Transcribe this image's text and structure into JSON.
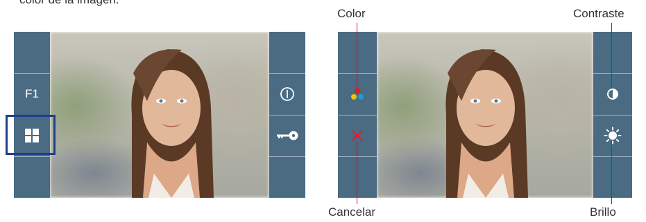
{
  "caption": "color de la imagen.",
  "left_screen": {
    "left_panel": {
      "f1_label": "F1",
      "menu_icon": "grid-icon"
    },
    "right_panel": {
      "power_icon": "power-icon",
      "key_icon": "key-icon"
    }
  },
  "right_screen": {
    "left_panel": {
      "color_icon": "color-dots-icon",
      "cancel_icon": "cancel-x-icon"
    },
    "right_panel": {
      "contrast_icon": "contrast-icon",
      "brightness_icon": "brightness-icon"
    }
  },
  "callouts": {
    "color": "Color",
    "contraste": "Contraste",
    "cancelar": "Cancelar",
    "brillo": "Brillo"
  },
  "colors": {
    "panel": "#4a6b82",
    "highlight": "#1c3f8f",
    "callout_line": "#c8102e"
  }
}
